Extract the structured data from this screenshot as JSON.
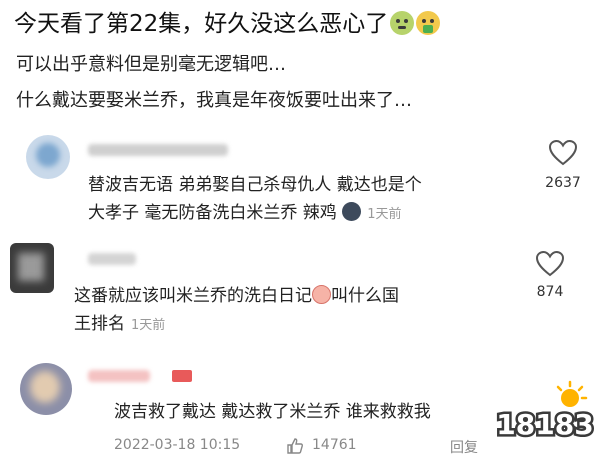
{
  "post": {
    "title": "今天看了第22集，好久没这么恶心了",
    "line1": "可以出乎意料但是别毫无逻辑吧…",
    "line2": "什么戴达要娶米兰乔，我真是年夜饭要吐出来了…",
    "title_emojis": [
      "nauseated-face-icon",
      "vomiting-face-icon"
    ]
  },
  "comments": [
    {
      "text_line1": "替波吉无语  弟弟娶自己杀母仇人  戴达也是个",
      "text_line2": "大孝子   毫无防备洗白米兰乔  辣鸡",
      "emoji": "new-moon-face-icon",
      "time": "1天前",
      "likes": "2637"
    },
    {
      "text_line1": "这番就应该叫米兰乔的洗白日记",
      "text_line1b": "叫什么国",
      "text_line2": "王排名",
      "emoji": "peach-icon",
      "time": "1天前",
      "likes": "874"
    },
    {
      "text_line1": "波吉救了戴达  戴达救了米兰乔  谁来救救我",
      "date": "2022-03-18 10:15",
      "likes": "14761",
      "reply_label": "回复"
    }
  ],
  "watermark": {
    "text": "18183"
  }
}
